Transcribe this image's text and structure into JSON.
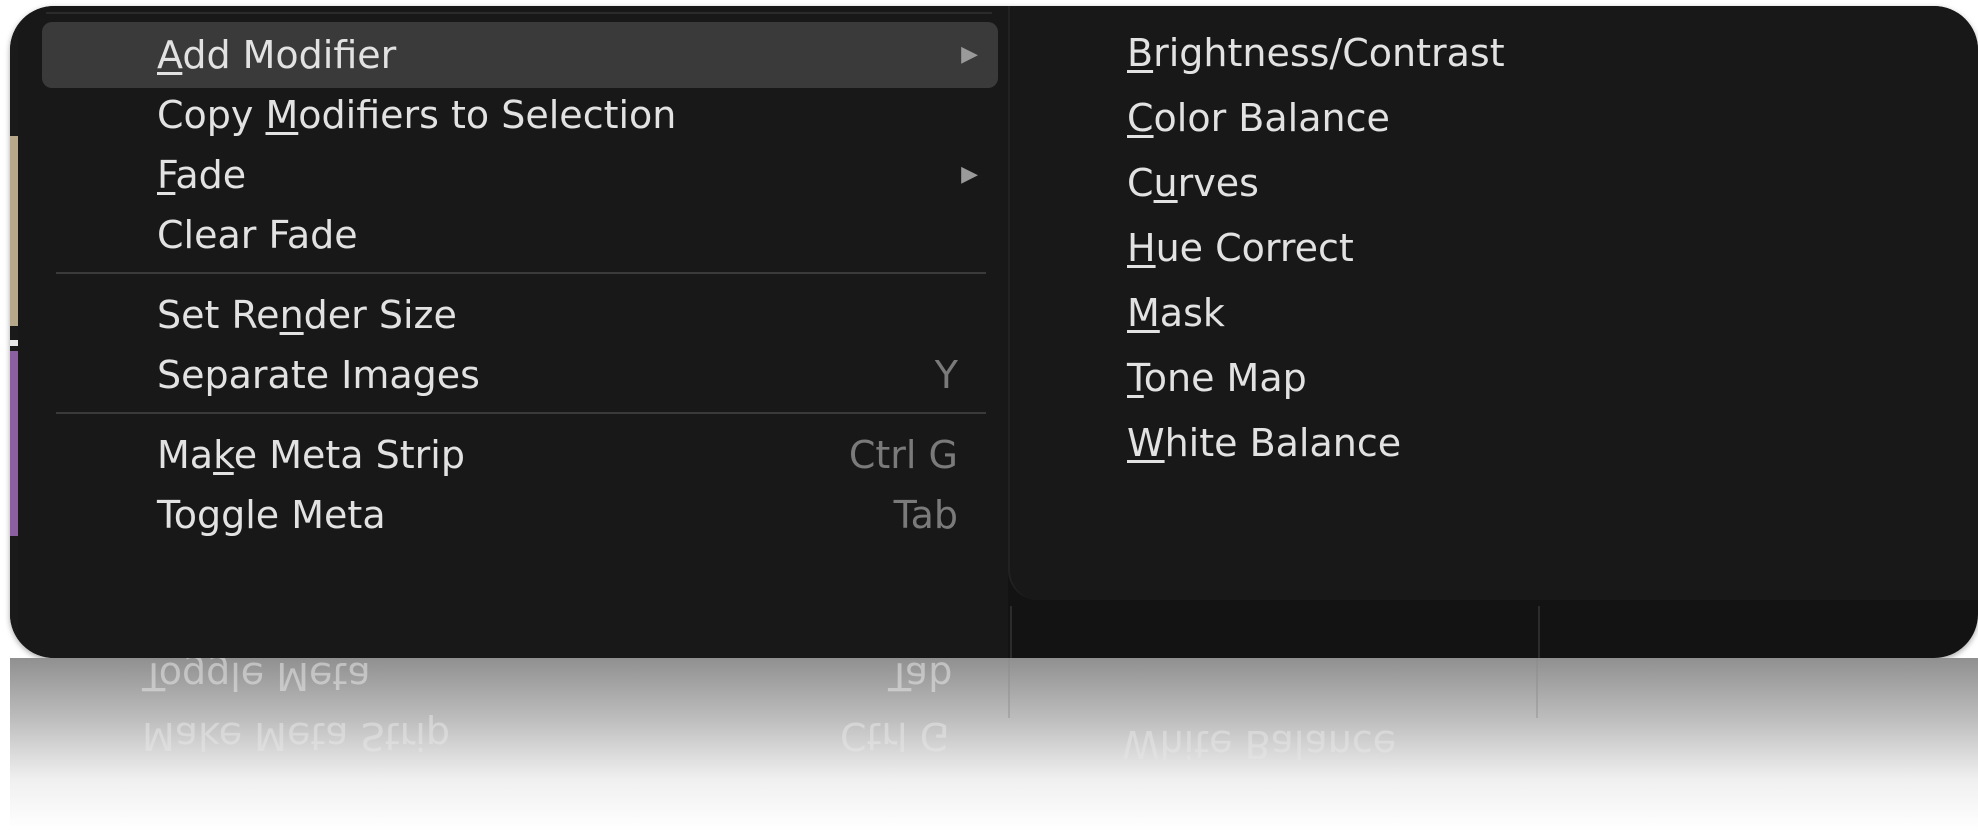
{
  "menu": {
    "items": [
      {
        "pre": "",
        "u": "A",
        "post": "dd Modifier",
        "shortcut": "",
        "arrow": "▶"
      },
      {
        "pre": "Copy ",
        "u": "M",
        "post": "odifiers to Selection",
        "shortcut": "",
        "arrow": ""
      },
      {
        "pre": "",
        "u": "F",
        "post": "ade",
        "shortcut": "",
        "arrow": "▶"
      },
      {
        "pre": "Clear Fade",
        "u": "",
        "post": "",
        "shortcut": "",
        "arrow": ""
      },
      {
        "pre": "Set Re",
        "u": "n",
        "post": "der Size",
        "shortcut": "",
        "arrow": ""
      },
      {
        "pre": "Separate Images",
        "u": "",
        "post": "",
        "shortcut": "Y",
        "arrow": ""
      },
      {
        "pre": "Ma",
        "u": "k",
        "post": "e Meta Strip",
        "shortcut": "Ctrl G",
        "arrow": ""
      },
      {
        "pre": "Toggle Meta",
        "u": "",
        "post": "",
        "shortcut": "Tab",
        "arrow": ""
      }
    ]
  },
  "submenu": {
    "items": [
      {
        "u": "B",
        "post": "rightness/Contrast"
      },
      {
        "u": "C",
        "post": "olor Balance"
      },
      {
        "pre": "C",
        "u": "u",
        "post": "rves"
      },
      {
        "u": "H",
        "post": "ue Correct"
      },
      {
        "u": "M",
        "post": "ask"
      },
      {
        "u": "T",
        "post": "one Map"
      },
      {
        "u": "W",
        "post": "hite Balance"
      }
    ]
  },
  "reflection": {
    "toggle_meta": "Toggle Meta",
    "tab": "Tab",
    "make_meta_strip": "Make Meta Strip",
    "ctrl_g": "Ctrl G",
    "white_balance": "White Balance"
  },
  "colors": {
    "menu_bg": "#181818",
    "highlight": "#3a3a3a",
    "text": "#e2e2e2",
    "shortcut": "#7a7a7a",
    "separator": "#3a3a3a"
  },
  "icons": {
    "submenu_arrow": "submenu-arrow-icon"
  }
}
